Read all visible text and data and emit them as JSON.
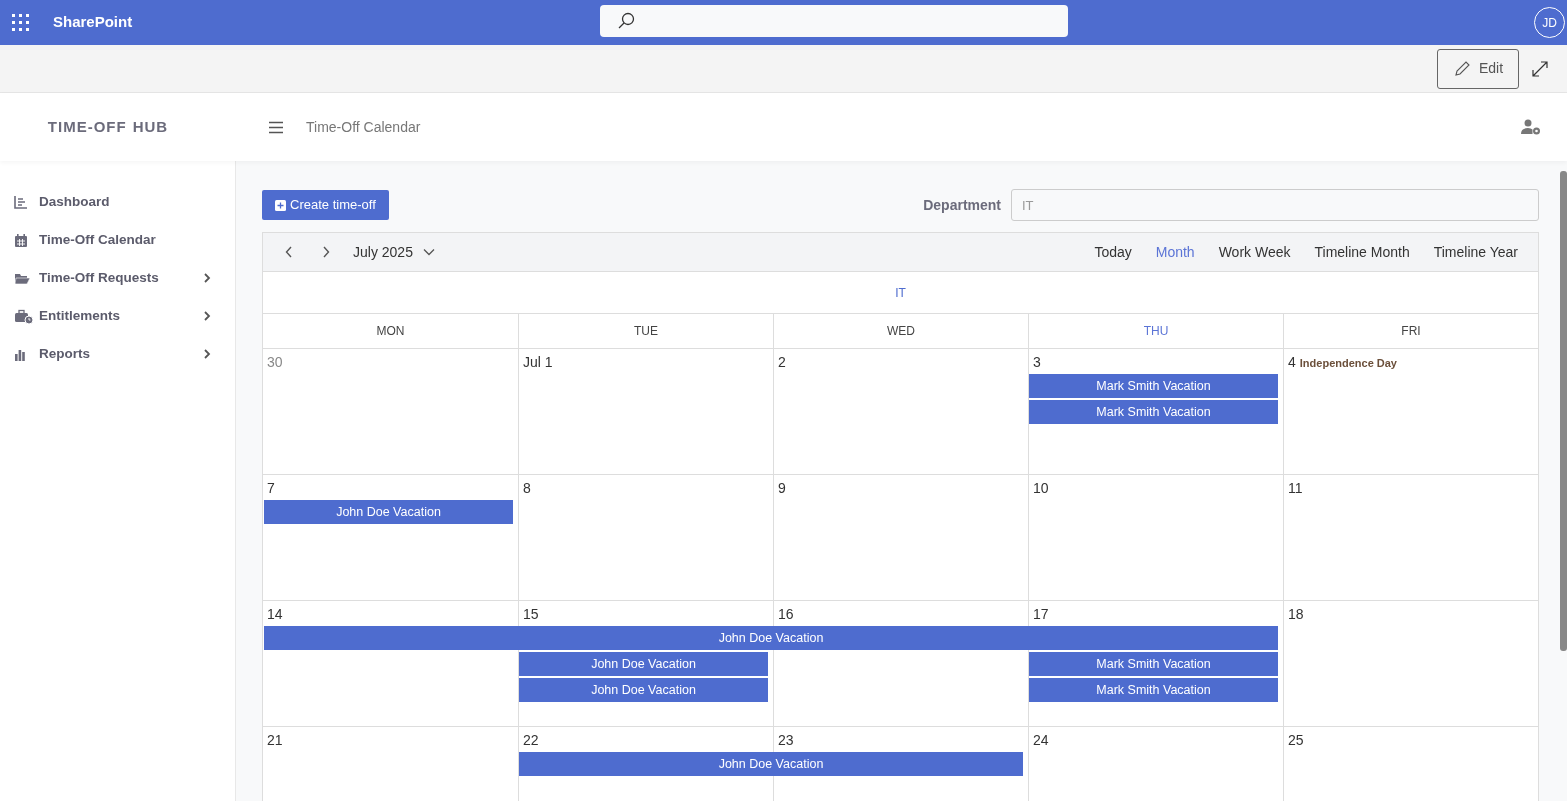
{
  "topbar": {
    "app_name": "SharePoint",
    "avatar": "JD"
  },
  "toolbar": {
    "edit_button": "Edit"
  },
  "header": {
    "logo_light": "TIME-OFF",
    "logo_bold": "HUB",
    "page_title": "Time-Off Calendar"
  },
  "sidebar": {
    "items": [
      {
        "label": "Dashboard",
        "expandable": false
      },
      {
        "label": "Time-Off Calendar",
        "expandable": false
      },
      {
        "label": "Time-Off Requests",
        "expandable": true
      },
      {
        "label": "Entitlements",
        "expandable": true
      },
      {
        "label": "Reports",
        "expandable": true
      }
    ]
  },
  "actions": {
    "create_button": "Create time-off",
    "department_label": "Department",
    "department_value": "IT"
  },
  "calendar": {
    "period": "July 2025",
    "views": [
      {
        "label": "Today",
        "selected": false
      },
      {
        "label": "Month",
        "selected": true
      },
      {
        "label": "Work Week",
        "selected": false
      },
      {
        "label": "Timeline Month",
        "selected": false
      },
      {
        "label": "Timeline Year",
        "selected": false
      }
    ],
    "group": "IT",
    "weekdays": [
      {
        "label": "MON",
        "today": false
      },
      {
        "label": "TUE",
        "today": false
      },
      {
        "label": "WED",
        "today": false
      },
      {
        "label": "THU",
        "today": true
      },
      {
        "label": "FRI",
        "today": false
      }
    ],
    "weeks": [
      {
        "days": [
          {
            "label": "30",
            "other_month": true
          },
          {
            "label": "Jul 1",
            "other_month": false
          },
          {
            "label": "2",
            "other_month": false
          },
          {
            "label": "3",
            "other_month": false,
            "events": [
              {
                "kind": "event",
                "title": "Mark Smith Vacation"
              },
              {
                "kind": "event",
                "title": "Mark Smith Vacation"
              }
            ]
          },
          {
            "label": "4",
            "other_month": false,
            "holiday": "Independence Day"
          }
        ]
      },
      {
        "days": [
          {
            "label": "7",
            "other_month": false,
            "events": [
              {
                "kind": "event",
                "title": "John Doe Vacation"
              }
            ]
          },
          {
            "label": "8",
            "other_month": false
          },
          {
            "label": "9",
            "other_month": false
          },
          {
            "label": "10",
            "other_month": false
          },
          {
            "label": "11",
            "other_month": false
          }
        ]
      },
      {
        "days": [
          {
            "label": "14",
            "other_month": false,
            "events": [
              {
                "kind": "event",
                "title": "John Doe Vacation"
              }
            ]
          },
          {
            "label": "15",
            "other_month": false,
            "events": [
              {
                "kind": "continuation"
              },
              {
                "kind": "event",
                "title": "John Doe Vacation"
              },
              {
                "kind": "event",
                "title": "John Doe Vacation"
              }
            ]
          },
          {
            "label": "16",
            "other_month": false,
            "events": [
              {
                "kind": "continuation"
              }
            ]
          },
          {
            "label": "17",
            "other_month": false,
            "events": [
              {
                "kind": "continuation"
              },
              {
                "kind": "event",
                "title": "Mark Smith Vacation"
              },
              {
                "kind": "event",
                "title": "Mark Smith Vacation"
              }
            ]
          },
          {
            "label": "18",
            "other_month": false
          }
        ]
      },
      {
        "days": [
          {
            "label": "21",
            "other_month": false
          },
          {
            "label": "22",
            "other_month": false,
            "events": [
              {
                "kind": "event",
                "title": "John Doe Vacation"
              }
            ]
          },
          {
            "label": "23",
            "other_month": false,
            "events": [
              {
                "kind": "continuation"
              }
            ]
          },
          {
            "label": "24",
            "other_month": false
          },
          {
            "label": "25",
            "other_month": false
          }
        ]
      }
    ]
  }
}
